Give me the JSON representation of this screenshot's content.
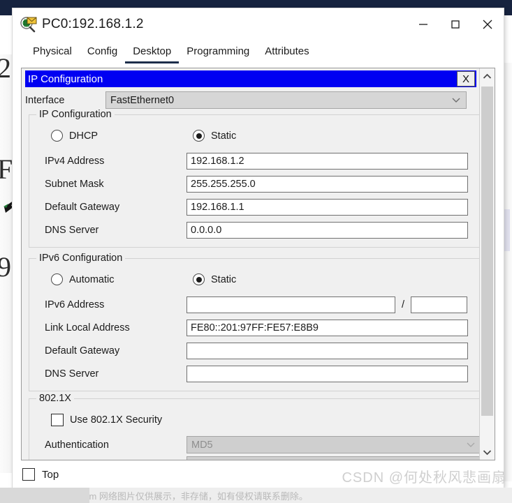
{
  "window": {
    "title": "PC0:192.168.1.2",
    "icon": "packet-tracer-magnifier-icon",
    "controls": {
      "minimize": "—",
      "maximize": "☐",
      "close": "✕"
    }
  },
  "tabs": [
    {
      "label": "Physical",
      "active": false
    },
    {
      "label": "Config",
      "active": false
    },
    {
      "label": "Desktop",
      "active": true
    },
    {
      "label": "Programming",
      "active": false
    },
    {
      "label": "Attributes",
      "active": false
    }
  ],
  "ip_config_panel": {
    "caption": "IP Configuration",
    "close_label": "X",
    "interface": {
      "label": "Interface",
      "value": "FastEthernet0"
    },
    "ipv4": {
      "group_title": "IP Configuration",
      "mode": {
        "dhcp_label": "DHCP",
        "dhcp_selected": false,
        "static_label": "Static",
        "static_selected": true
      },
      "fields": [
        {
          "label": "IPv4 Address",
          "value": "192.168.1.2"
        },
        {
          "label": "Subnet Mask",
          "value": "255.255.255.0"
        },
        {
          "label": "Default Gateway",
          "value": "192.168.1.1"
        },
        {
          "label": "DNS Server",
          "value": "0.0.0.0"
        }
      ]
    },
    "ipv6": {
      "group_title": "IPv6 Configuration",
      "mode": {
        "automatic_label": "Automatic",
        "automatic_selected": false,
        "static_label": "Static",
        "static_selected": true
      },
      "address_label": "IPv6 Address",
      "address_value": "",
      "prefix_separator": "/",
      "prefix_value": "",
      "fields": [
        {
          "label": "Link Local Address",
          "value": "FE80::201:97FF:FE57:E8B9"
        },
        {
          "label": "Default Gateway",
          "value": ""
        },
        {
          "label": "DNS Server",
          "value": ""
        }
      ]
    },
    "dot1x": {
      "group_title": "802.1X",
      "use_security_label": "Use 802.1X Security",
      "use_security_checked": false,
      "authentication_label": "Authentication",
      "authentication_value": "MD5",
      "authentication_disabled": true
    }
  },
  "bottom": {
    "top_checkbox_label": "Top",
    "top_checkbox_checked": false
  },
  "watermarks": {
    "csdn": "CSDN @何处秋风悲画扇",
    "toymoban": "www.toymoban.com 网络图片仅供展示，非存储，如有侵权请联系删除。"
  },
  "background_fragments": [
    "2",
    "F",
    "9"
  ],
  "colors": {
    "caption_blue": "#0000f2",
    "titlebar_navy": "#16233f",
    "tab_underline": "#1d2e4b",
    "panel_grey": "#f0f0f0"
  }
}
